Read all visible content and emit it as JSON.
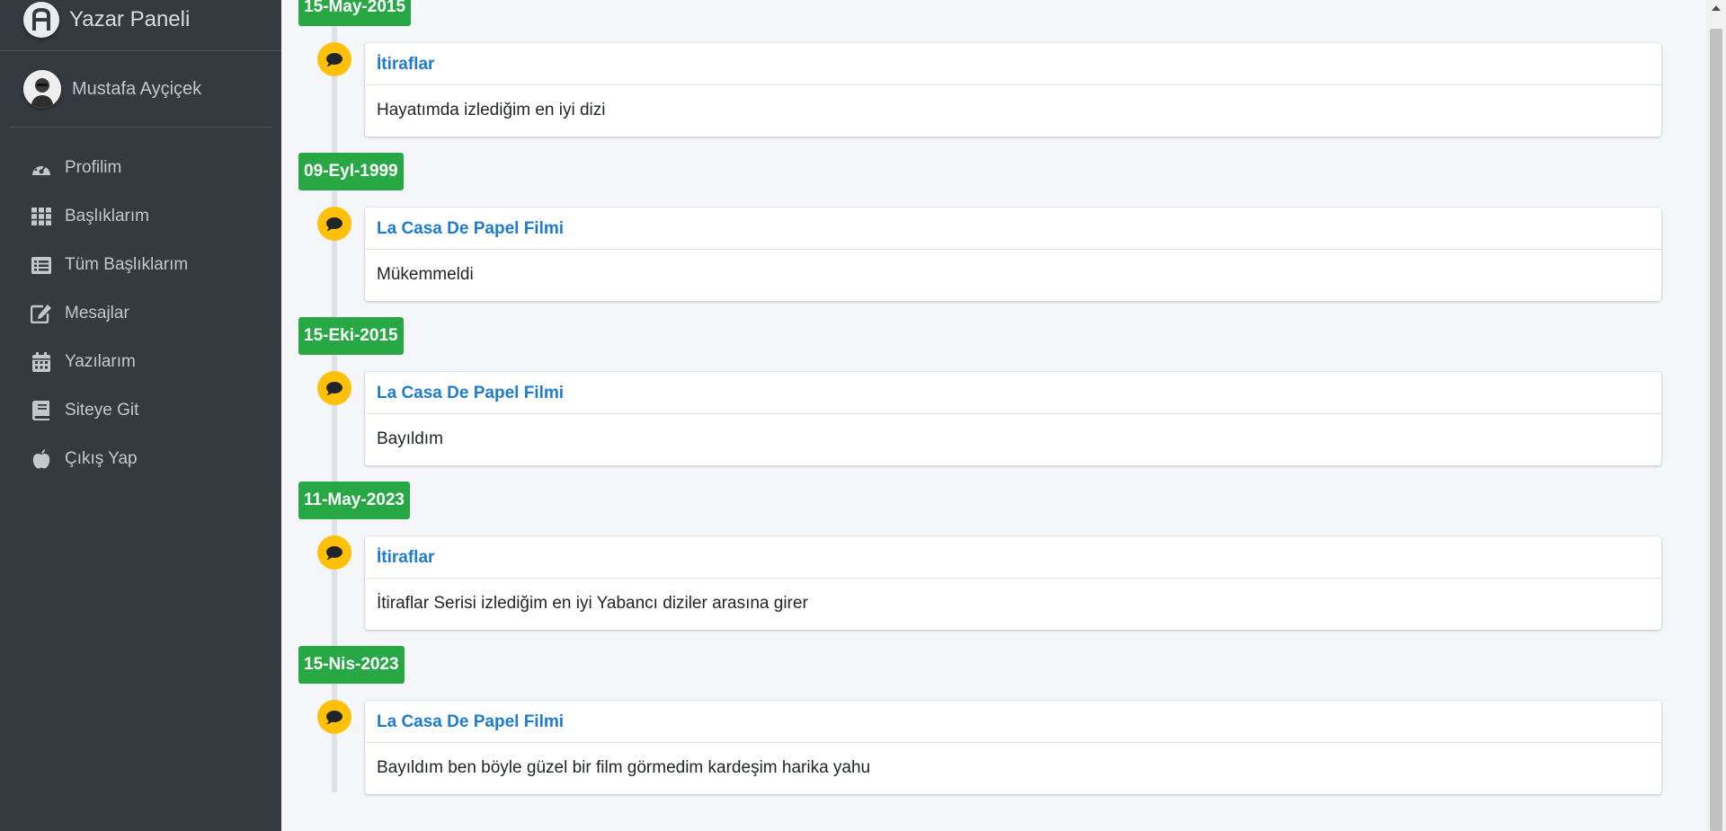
{
  "sidebar": {
    "brand": "Yazar Paneli",
    "user_name": "Mustafa Ayçiçek",
    "items": [
      {
        "label": "Profilim",
        "icon": "tachometer-icon"
      },
      {
        "label": "Başlıklarım",
        "icon": "th-grid-icon"
      },
      {
        "label": "Tüm Başlıklarım",
        "icon": "list-alt-icon"
      },
      {
        "label": "Mesajlar",
        "icon": "edit-icon"
      },
      {
        "label": "Yazılarım",
        "icon": "calendar-icon"
      },
      {
        "label": "Siteye Git",
        "icon": "book-icon"
      },
      {
        "label": "Çıkış Yap",
        "icon": "apple-icon"
      }
    ]
  },
  "timeline": [
    {
      "date": "15-May-2015",
      "title": "İtiraflar",
      "body": "Hayatımda izlediğim en iyi dizi"
    },
    {
      "date": "09-Eyl-1999",
      "title": "La Casa De Papel Filmi",
      "body": "Mükemmeldi"
    },
    {
      "date": "15-Eki-2015",
      "title": "La Casa De Papel Filmi",
      "body": "Bayıldım"
    },
    {
      "date": "11-May-2023",
      "title": "İtiraflar",
      "body": "İtiraflar Serisi izlediğim en iyi Yabancı diziler arasına girer"
    },
    {
      "date": "15-Nis-2023",
      "title": "La Casa De Papel Filmi",
      "body": "Bayıldım ben böyle güzel bir film görmedim kardeşim harika yahu"
    }
  ],
  "colors": {
    "sidebar_bg": "#343a40",
    "date_label": "#28a745",
    "timeline_icon": "#ffc107",
    "link": "#1f7bd0"
  },
  "timeline_icon_name": "comment-icon"
}
